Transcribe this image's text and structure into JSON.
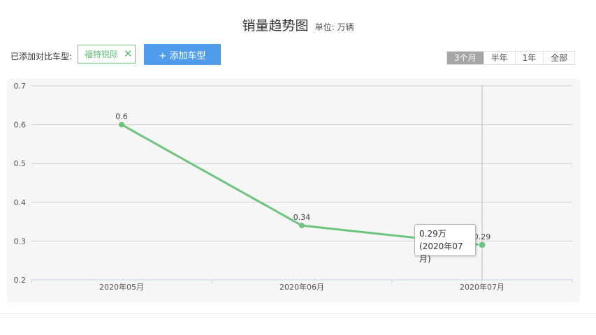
{
  "header": {
    "title": "销量趋势图",
    "unit": "单位: 万辆"
  },
  "compare": {
    "label": "已添加对比车型:",
    "tag": "福特锐际",
    "add_button": "+ 添加车型"
  },
  "range_tabs": [
    "3个月",
    "半年",
    "1年",
    "全部"
  ],
  "active_range": "3个月",
  "tooltip": {
    "value": "0.29万",
    "period": "(2020年07月)"
  },
  "colors": {
    "line": "#6cc47e",
    "accent": "#4f9bec"
  },
  "chart_data": {
    "type": "line",
    "categories": [
      "2020年05月",
      "2020年06月",
      "2020年07月"
    ],
    "values": [
      0.6,
      0.34,
      0.29
    ],
    "value_labels": [
      "0.6",
      "0.34",
      "0.29"
    ],
    "y_ticks": [
      "0.2",
      "0.3",
      "0.4",
      "0.5",
      "0.6",
      "0.7"
    ],
    "ylim": [
      0.2,
      0.7
    ],
    "grid": true,
    "highlighted_index": 2
  }
}
